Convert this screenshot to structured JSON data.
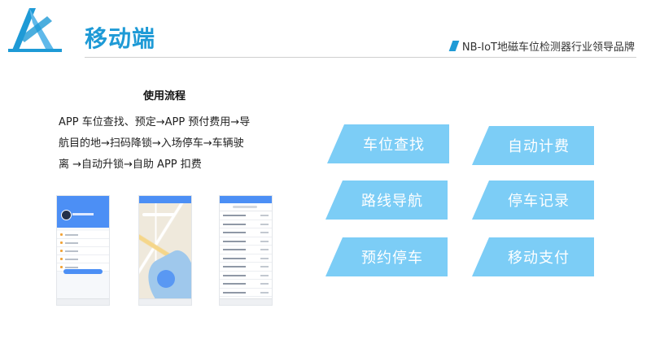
{
  "header": {
    "title": "移动端",
    "tagline": "NB-IoT地磁车位检测器行业领导品牌"
  },
  "usage": {
    "heading": "使用流程",
    "flow_lines": [
      "APP 车位查找、预定→APP 预付费用→导",
      "航目的地→扫码降锁→入场停车→车辆驶",
      "离 →自动升锁→自助 APP 扣费"
    ]
  },
  "features": [
    "车位查找",
    "自动计费",
    "路线导航",
    "停车记录",
    "预约停车",
    "移动支付"
  ],
  "colors": {
    "title": "#1e9ad6",
    "feature_bg": "#7ccdf6",
    "phone_accent": "#4c8ff5"
  },
  "screens": [
    "profile-screen",
    "map-screen",
    "parking-list-screen"
  ]
}
